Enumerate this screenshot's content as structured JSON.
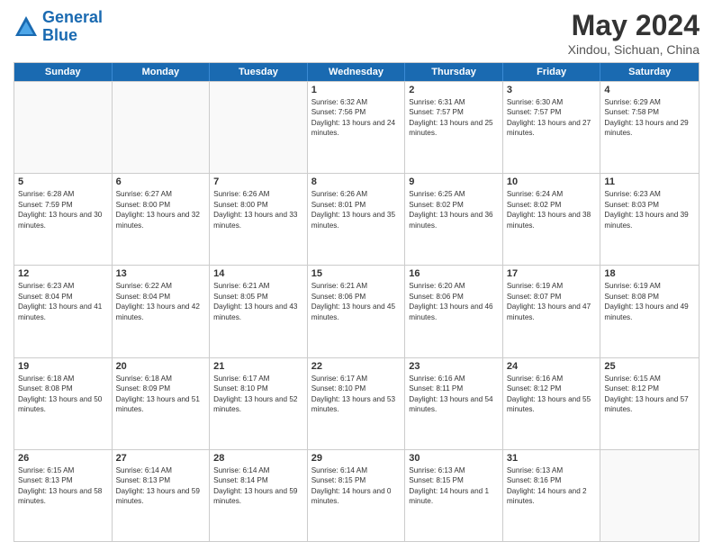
{
  "header": {
    "logo_line1": "General",
    "logo_line2": "Blue",
    "month_year": "May 2024",
    "location": "Xindou, Sichuan, China"
  },
  "days_of_week": [
    "Sunday",
    "Monday",
    "Tuesday",
    "Wednesday",
    "Thursday",
    "Friday",
    "Saturday"
  ],
  "weeks": [
    [
      {
        "day": "",
        "sunrise": "",
        "sunset": "",
        "daylight": ""
      },
      {
        "day": "",
        "sunrise": "",
        "sunset": "",
        "daylight": ""
      },
      {
        "day": "",
        "sunrise": "",
        "sunset": "",
        "daylight": ""
      },
      {
        "day": "1",
        "sunrise": "Sunrise: 6:32 AM",
        "sunset": "Sunset: 7:56 PM",
        "daylight": "Daylight: 13 hours and 24 minutes."
      },
      {
        "day": "2",
        "sunrise": "Sunrise: 6:31 AM",
        "sunset": "Sunset: 7:57 PM",
        "daylight": "Daylight: 13 hours and 25 minutes."
      },
      {
        "day": "3",
        "sunrise": "Sunrise: 6:30 AM",
        "sunset": "Sunset: 7:57 PM",
        "daylight": "Daylight: 13 hours and 27 minutes."
      },
      {
        "day": "4",
        "sunrise": "Sunrise: 6:29 AM",
        "sunset": "Sunset: 7:58 PM",
        "daylight": "Daylight: 13 hours and 29 minutes."
      }
    ],
    [
      {
        "day": "5",
        "sunrise": "Sunrise: 6:28 AM",
        "sunset": "Sunset: 7:59 PM",
        "daylight": "Daylight: 13 hours and 30 minutes."
      },
      {
        "day": "6",
        "sunrise": "Sunrise: 6:27 AM",
        "sunset": "Sunset: 8:00 PM",
        "daylight": "Daylight: 13 hours and 32 minutes."
      },
      {
        "day": "7",
        "sunrise": "Sunrise: 6:26 AM",
        "sunset": "Sunset: 8:00 PM",
        "daylight": "Daylight: 13 hours and 33 minutes."
      },
      {
        "day": "8",
        "sunrise": "Sunrise: 6:26 AM",
        "sunset": "Sunset: 8:01 PM",
        "daylight": "Daylight: 13 hours and 35 minutes."
      },
      {
        "day": "9",
        "sunrise": "Sunrise: 6:25 AM",
        "sunset": "Sunset: 8:02 PM",
        "daylight": "Daylight: 13 hours and 36 minutes."
      },
      {
        "day": "10",
        "sunrise": "Sunrise: 6:24 AM",
        "sunset": "Sunset: 8:02 PM",
        "daylight": "Daylight: 13 hours and 38 minutes."
      },
      {
        "day": "11",
        "sunrise": "Sunrise: 6:23 AM",
        "sunset": "Sunset: 8:03 PM",
        "daylight": "Daylight: 13 hours and 39 minutes."
      }
    ],
    [
      {
        "day": "12",
        "sunrise": "Sunrise: 6:23 AM",
        "sunset": "Sunset: 8:04 PM",
        "daylight": "Daylight: 13 hours and 41 minutes."
      },
      {
        "day": "13",
        "sunrise": "Sunrise: 6:22 AM",
        "sunset": "Sunset: 8:04 PM",
        "daylight": "Daylight: 13 hours and 42 minutes."
      },
      {
        "day": "14",
        "sunrise": "Sunrise: 6:21 AM",
        "sunset": "Sunset: 8:05 PM",
        "daylight": "Daylight: 13 hours and 43 minutes."
      },
      {
        "day": "15",
        "sunrise": "Sunrise: 6:21 AM",
        "sunset": "Sunset: 8:06 PM",
        "daylight": "Daylight: 13 hours and 45 minutes."
      },
      {
        "day": "16",
        "sunrise": "Sunrise: 6:20 AM",
        "sunset": "Sunset: 8:06 PM",
        "daylight": "Daylight: 13 hours and 46 minutes."
      },
      {
        "day": "17",
        "sunrise": "Sunrise: 6:19 AM",
        "sunset": "Sunset: 8:07 PM",
        "daylight": "Daylight: 13 hours and 47 minutes."
      },
      {
        "day": "18",
        "sunrise": "Sunrise: 6:19 AM",
        "sunset": "Sunset: 8:08 PM",
        "daylight": "Daylight: 13 hours and 49 minutes."
      }
    ],
    [
      {
        "day": "19",
        "sunrise": "Sunrise: 6:18 AM",
        "sunset": "Sunset: 8:08 PM",
        "daylight": "Daylight: 13 hours and 50 minutes."
      },
      {
        "day": "20",
        "sunrise": "Sunrise: 6:18 AM",
        "sunset": "Sunset: 8:09 PM",
        "daylight": "Daylight: 13 hours and 51 minutes."
      },
      {
        "day": "21",
        "sunrise": "Sunrise: 6:17 AM",
        "sunset": "Sunset: 8:10 PM",
        "daylight": "Daylight: 13 hours and 52 minutes."
      },
      {
        "day": "22",
        "sunrise": "Sunrise: 6:17 AM",
        "sunset": "Sunset: 8:10 PM",
        "daylight": "Daylight: 13 hours and 53 minutes."
      },
      {
        "day": "23",
        "sunrise": "Sunrise: 6:16 AM",
        "sunset": "Sunset: 8:11 PM",
        "daylight": "Daylight: 13 hours and 54 minutes."
      },
      {
        "day": "24",
        "sunrise": "Sunrise: 6:16 AM",
        "sunset": "Sunset: 8:12 PM",
        "daylight": "Daylight: 13 hours and 55 minutes."
      },
      {
        "day": "25",
        "sunrise": "Sunrise: 6:15 AM",
        "sunset": "Sunset: 8:12 PM",
        "daylight": "Daylight: 13 hours and 57 minutes."
      }
    ],
    [
      {
        "day": "26",
        "sunrise": "Sunrise: 6:15 AM",
        "sunset": "Sunset: 8:13 PM",
        "daylight": "Daylight: 13 hours and 58 minutes."
      },
      {
        "day": "27",
        "sunrise": "Sunrise: 6:14 AM",
        "sunset": "Sunset: 8:13 PM",
        "daylight": "Daylight: 13 hours and 59 minutes."
      },
      {
        "day": "28",
        "sunrise": "Sunrise: 6:14 AM",
        "sunset": "Sunset: 8:14 PM",
        "daylight": "Daylight: 13 hours and 59 minutes."
      },
      {
        "day": "29",
        "sunrise": "Sunrise: 6:14 AM",
        "sunset": "Sunset: 8:15 PM",
        "daylight": "Daylight: 14 hours and 0 minutes."
      },
      {
        "day": "30",
        "sunrise": "Sunrise: 6:13 AM",
        "sunset": "Sunset: 8:15 PM",
        "daylight": "Daylight: 14 hours and 1 minute."
      },
      {
        "day": "31",
        "sunrise": "Sunrise: 6:13 AM",
        "sunset": "Sunset: 8:16 PM",
        "daylight": "Daylight: 14 hours and 2 minutes."
      },
      {
        "day": "",
        "sunrise": "",
        "sunset": "",
        "daylight": ""
      }
    ]
  ]
}
